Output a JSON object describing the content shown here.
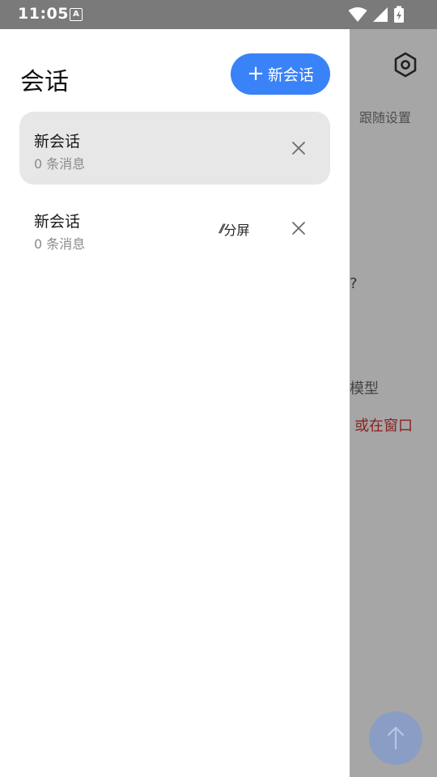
{
  "statusbar": {
    "time": "11:05",
    "input_icon_letter": "A"
  },
  "background": {
    "follow_settings": "跟随设置",
    "question_fragment": "?",
    "model_fragment": "模型",
    "window_fragment": "或在窗口",
    "accent_red": "#8a1f1f"
  },
  "drawer": {
    "title": "会话",
    "new_button": {
      "plus": "+",
      "label": "新会话"
    },
    "sessions": [
      {
        "name": "新会话",
        "count": "0 条消息",
        "active": true
      },
      {
        "name": "新会话",
        "count": "0 条消息",
        "active": false,
        "split_label": "分屏",
        "split_icon": "//"
      }
    ]
  },
  "colors": {
    "accent": "#3a82f7",
    "scrim": "#a6a6a6",
    "active_item_bg": "#e7e7e7"
  }
}
